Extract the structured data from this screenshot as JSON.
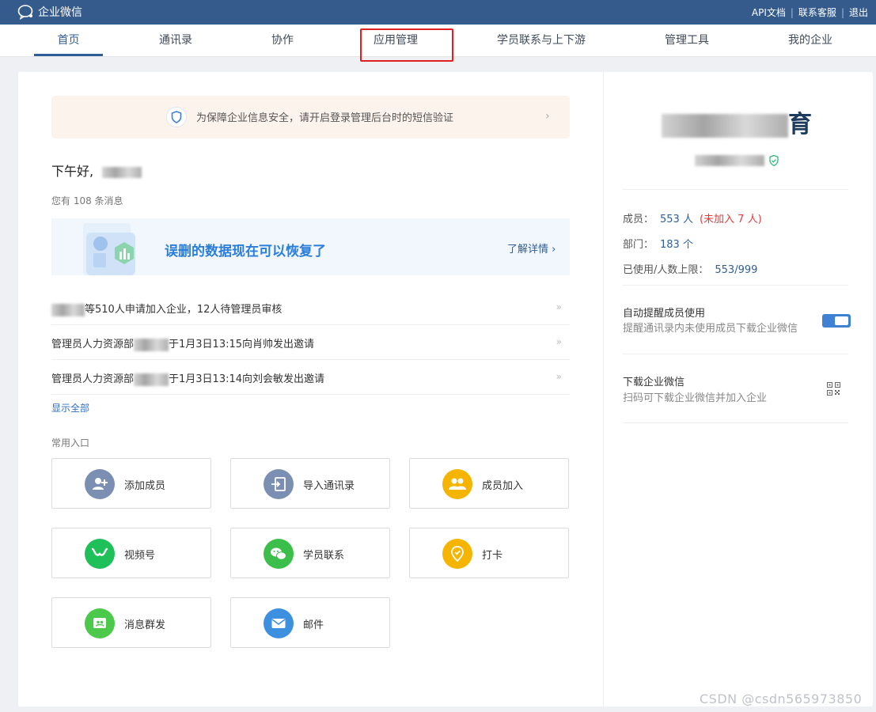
{
  "topbar": {
    "brand": "企业微信",
    "links": [
      "API文档",
      "联系客服",
      "退出"
    ],
    "separator": "|"
  },
  "nav": {
    "items": [
      "首页",
      "通讯录",
      "协作",
      "应用管理",
      "学员联系与上下游",
      "管理工具",
      "我的企业"
    ],
    "active": "首页",
    "highlighted": "应用管理"
  },
  "colors": {
    "topbar": "#345b8c",
    "accent": "#2f5e95",
    "highlight_border": "#e02020",
    "warning_text": "#e03c3c"
  },
  "notice": {
    "text": "为保障企业信息安全，请开启登录管理后台时的短信验证",
    "icon": "shield-icon",
    "arrow": "›"
  },
  "greeting": "下午好,",
  "message_count": "您有 108 条消息",
  "banner": {
    "title": "误删的数据现在可以恢复了",
    "link": "了解详情 ›"
  },
  "messages": [
    {
      "text": "等510人申请加入企业，12人待管理员审核",
      "arrow": "»"
    },
    {
      "text_before": "管理员人力资源部",
      "text_after": "于1月3日13:15向肖帅发出邀请",
      "arrow": "»"
    },
    {
      "text_before": "管理员人力资源部",
      "text_after": "于1月3日13:14向刘会敏发出邀请",
      "arrow": "»"
    }
  ],
  "show_all": "显示全部",
  "shortcuts_label": "常用入口",
  "shortcuts": [
    {
      "label": "添加成员",
      "icon": "add-user-icon",
      "color": "#7b8fb3"
    },
    {
      "label": "导入通讯录",
      "icon": "import-icon",
      "color": "#7b8fb3"
    },
    {
      "label": "成员加入",
      "icon": "group-icon",
      "color": "#f4b400"
    },
    {
      "label": "视频号",
      "icon": "channels-icon",
      "color": "#1fc05a"
    },
    {
      "label": "学员联系",
      "icon": "wechat-icon",
      "color": "#3bbf4a"
    },
    {
      "label": "打卡",
      "icon": "checkin-icon",
      "color": "#f4b400"
    },
    {
      "label": "消息群发",
      "icon": "broadcast-icon",
      "color": "#4cc94a"
    },
    {
      "label": "邮件",
      "icon": "mail-icon",
      "color": "#3d8fe0"
    }
  ],
  "company": {
    "name_suffix": "育"
  },
  "stats": {
    "members_label": "成员：",
    "members_value": "553 人",
    "members_pending": "(未加入 7 人)",
    "departments_label": "部门：",
    "departments_value": "183 个",
    "limit_label": "已使用/人数上限：",
    "limit_value": "553/999"
  },
  "auto_remind": {
    "title": "自动提醒成员使用",
    "desc": "提醒通讯录内未使用成员下载企业微信",
    "enabled": true
  },
  "download": {
    "title": "下载企业微信",
    "desc": "扫码可下载企业微信并加入企业",
    "icon": "qrcode-icon"
  },
  "watermark": "CSDN @csdn565973850"
}
